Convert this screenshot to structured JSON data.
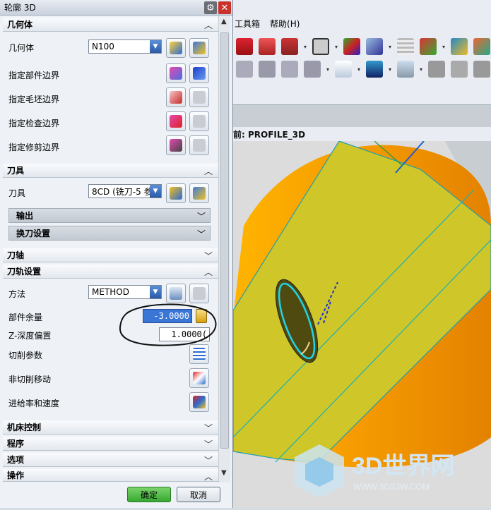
{
  "dialog": {
    "title": "轮廓 3D",
    "sections": {
      "geometry": "几何体",
      "tool": "刀具",
      "axis": "刀轴",
      "path_settings": "刀轨设置",
      "machine_control": "机床控制",
      "program": "程序",
      "options": "选项",
      "actions": "操作"
    },
    "geometry": {
      "label": "几何体",
      "value": "N100",
      "part_boundary": "指定部件边界",
      "blank_boundary": "指定毛坯边界",
      "check_boundary": "指定检查边界",
      "trim_boundary": "指定修剪边界"
    },
    "tool": {
      "label": "刀具",
      "value": "8CD (铣刀-5 参",
      "output": "输出",
      "tool_change": "换刀设置"
    },
    "path": {
      "method_label": "方法",
      "method_value": "METHOD",
      "stock_label": "部件余量",
      "stock_value": "-3.0000",
      "zdepth_label": "Z-深度偏置",
      "zdepth_value": "1.0000(",
      "cut_params": "切削参数",
      "non_cut": "非切削移动",
      "feeds": "进给率和速度"
    },
    "ok": "确定",
    "cancel": "取消"
  },
  "app": {
    "menu": [
      "工具箱",
      "帮助(H)"
    ],
    "view_label": "前: PROFILE_3D"
  },
  "watermark": {
    "text": "3D世界网",
    "url": "WWW.3DSJW.COM"
  },
  "colors": {
    "ok_green": "#36a832",
    "close_red": "#c8322a",
    "surface_yellow": "#cfc62a",
    "cylinder_orange": "#f0a100",
    "toolpath_cyan": "#22d3e6"
  }
}
